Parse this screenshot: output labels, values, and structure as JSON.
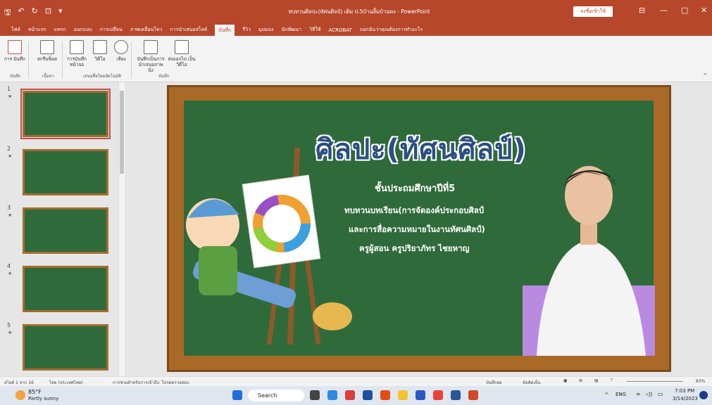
{
  "titlebar": {
    "title": "ทบทวนศิลปะ(ทัศนศิลป์) เติม ป.5บ้านลิ้มบ้านพง - PowerPoint",
    "sign_in": "ลงชื่อเข้าใช้"
  },
  "menu": [
    "ไฟล์",
    "หน้าแรก",
    "แทรก",
    "ออกแบบ",
    "การเปลี่ยน",
    "ภาพเคลื่อนไหว",
    "การนำเสนอสไลด์",
    "บันทึก",
    "รีวิว",
    "มุมมอง",
    "นักพัฒนา",
    "วิธีใช้",
    "ACROBAT",
    "บอกฉันว่าคุณต้องการทำอะไร"
  ],
  "menu_active_index": 7,
  "ribbon": {
    "buttons": [
      "การ บันทึก",
      "สกรีนช็อต",
      "การบันทึก หน้าจอ",
      "วิดีโอ",
      "เสียง",
      "บันทึกเป็นการ นำเสนอภาพนิ่ง",
      "ส่งออกไป เป็นวิดีโอ"
    ],
    "groups": [
      "บันทึก",
      "เนื้อหา",
      "เสนอสื่อโดยอัตโนมัติ",
      "บันทึก"
    ]
  },
  "thumbnails": [
    "1",
    "2",
    "3",
    "4",
    "5"
  ],
  "slide": {
    "title": "ศิลปะ(ทัศนศิลป์)",
    "line1": "ชั้นประถมศึกษาปีที่5",
    "line2": "ทบทวนบทเรียน(การจัดองค์ประกอบศิลป์",
    "line3": "และการสื่อความหมายในงานทัศนศิลป์)",
    "line4": "ครูผู้สอน  ครูปริยาภัทร ไชยหาญ"
  },
  "status": {
    "slide_counter": "สไลด์ 1 จาก 16",
    "language": "ไทย (ประเทศไทย)",
    "accessibility": "การช่วยสำหรับการเข้าถึง: โปรดตรวจสอบ",
    "notes": "บันทึกย่อ",
    "comments": "ข้อคิดเห็น",
    "zoom": "83%"
  },
  "taskbar": {
    "temp": "85°F",
    "weather": "Partly sunny",
    "search": "Search",
    "lang": "ENG",
    "time": "7:03 PM",
    "date": "3/14/2023"
  }
}
